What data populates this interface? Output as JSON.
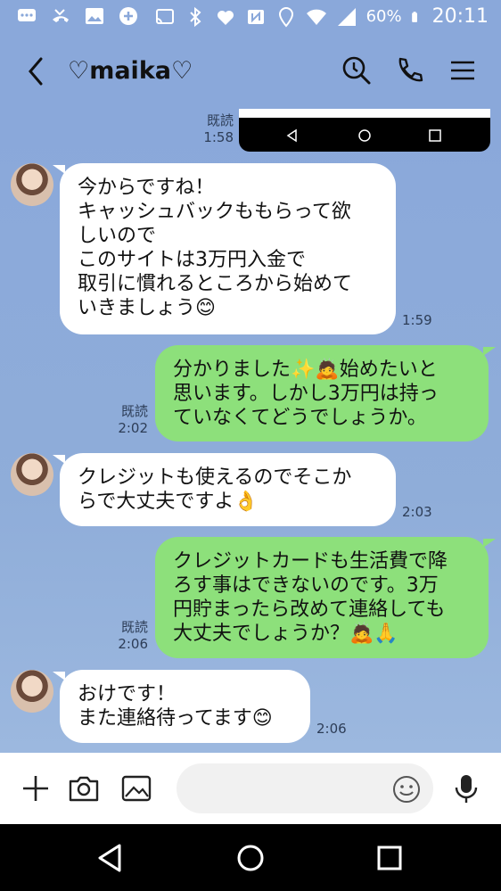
{
  "status_bar": {
    "battery": "60%",
    "time": "20:11"
  },
  "header": {
    "title": "♡maika♡"
  },
  "chat": {
    "pre_image": {
      "read_label": "既読",
      "time": "1:58"
    },
    "messages": [
      {
        "side": "in",
        "lines": [
          "今からですね！",
          "キャッシュバックももらって欲",
          "しいので",
          "このサイトは3万円入金で",
          "取引に慣れるところから始めて",
          "いきましょう😊"
        ],
        "time": "1:59"
      },
      {
        "side": "out",
        "lines": [
          "分かりました✨🙇始めたいと",
          "思います。しかし3万円は持っ",
          "ていなくてどうでしょうか。"
        ],
        "read_label": "既読",
        "time": "2:02"
      },
      {
        "side": "in",
        "lines": [
          "クレジットも使えるのでそこか",
          "らで大丈夫ですよ👌"
        ],
        "time": "2:03"
      },
      {
        "side": "out",
        "lines": [
          "クレジットカードも生活費で降",
          "ろす事はできないのです。3万",
          "円貯まったら改めて連絡しても",
          "大丈夫でしょうか？🙇🙏"
        ],
        "read_label": "既読",
        "time": "2:06"
      },
      {
        "side": "in",
        "lines": [
          "おけです！",
          "また連絡待ってます😊"
        ],
        "time": "2:06"
      }
    ]
  },
  "input_bar": {
    "placeholder": ""
  },
  "colors": {
    "chat_background": "#8aa9d9",
    "outgoing_bubble": "#8de07b",
    "incoming_bubble": "#ffffff"
  },
  "icons": [
    "back-icon",
    "search-clock-icon",
    "phone-icon",
    "menu-icon",
    "plus-icon",
    "camera-icon",
    "image-icon",
    "emoji-icon",
    "mic-icon",
    "nav-back-icon",
    "nav-home-icon",
    "nav-recents-icon"
  ]
}
